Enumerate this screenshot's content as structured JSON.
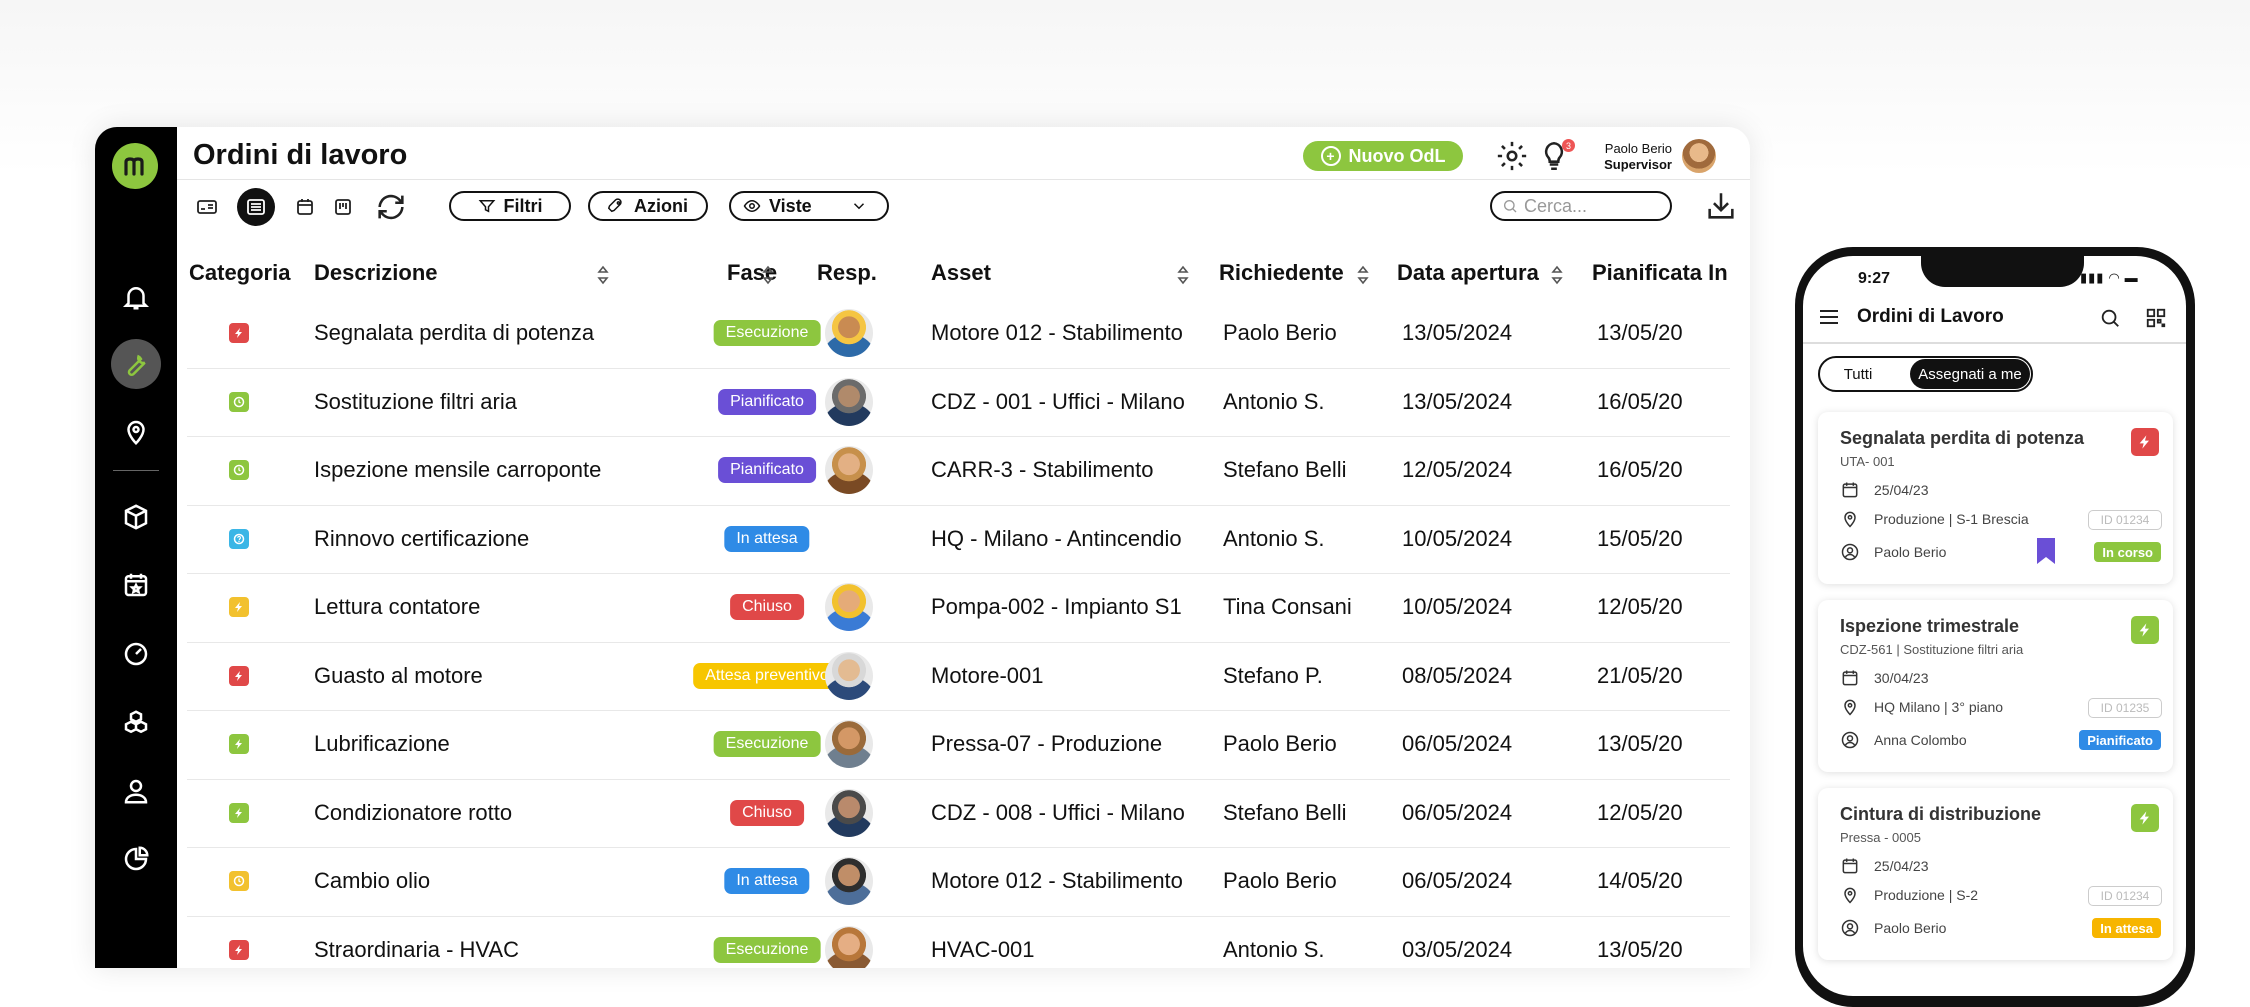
{
  "app": {
    "title": "Ordini di lavoro",
    "new_button": "Nuovo OdL",
    "notifications_count": "3",
    "user_name": "Paolo Berio",
    "user_role": "Supervisor",
    "filters_label": "Filtri",
    "actions_label": "Azioni",
    "views_label": "Viste",
    "search_placeholder": "Cerca...",
    "accent_color": "#8dc63f"
  },
  "table": {
    "headers": {
      "categoria": "Categoria",
      "descrizione": "Descrizione",
      "fase": "Fase",
      "resp": "Resp.",
      "asset": "Asset",
      "richiedente": "Richiedente",
      "data_apertura": "Data apertura",
      "pianificata": "Pianificata In"
    },
    "rows": [
      {
        "cat_color": "#e04848",
        "cat_icon": "bolt-icon",
        "descrizione": "Segnalata perdita di potenza",
        "fase": "Esecuzione",
        "fase_color": "#8dc63f",
        "asset": "Motore 012 - Stabilimento",
        "richiedente": "Paolo Berio",
        "data_apertura": "13/05/2024",
        "pianificata": "13/05/20",
        "resp_avatar": "person-avatar"
      },
      {
        "cat_color": "#8dc63f",
        "cat_icon": "clock-icon",
        "descrizione": "Sostituzione filtri aria",
        "fase": "Pianificato",
        "fase_color": "#6a4fd6",
        "asset": "CDZ - 001 - Uffici - Milano",
        "richiedente": "Antonio S.",
        "data_apertura": "13/05/2024",
        "pianificata": "16/05/20",
        "resp_avatar": "person-avatar"
      },
      {
        "cat_color": "#8dc63f",
        "cat_icon": "clock-icon",
        "descrizione": "Ispezione mensile carroponte",
        "fase": "Pianificato",
        "fase_color": "#6a4fd6",
        "asset": "CARR-3 - Stabilimento",
        "richiedente": "Stefano Belli",
        "data_apertura": "12/05/2024",
        "pianificata": "16/05/20",
        "resp_avatar": "person-avatar"
      },
      {
        "cat_color": "#3bb6e6",
        "cat_icon": "question-icon",
        "descrizione": "Rinnovo certificazione",
        "fase": "In attesa",
        "fase_color": "#2f8be6",
        "asset": "HQ - Milano - Antincendio",
        "richiedente": "Antonio S.",
        "data_apertura": "10/05/2024",
        "pianificata": "15/05/20",
        "resp_avatar": ""
      },
      {
        "cat_color": "#f2c12e",
        "cat_icon": "bolt-icon",
        "descrizione": "Lettura contatore",
        "fase": "Chiuso",
        "fase_color": "#e04848",
        "asset": "Pompa-002 - Impianto S1",
        "richiedente": "Tina Consani",
        "data_apertura": "10/05/2024",
        "pianificata": "12/05/20",
        "resp_avatar": "person-avatar"
      },
      {
        "cat_color": "#e04848",
        "cat_icon": "bolt-icon",
        "descrizione": "Guasto al motore",
        "fase": "Attesa preventivo",
        "fase_color": "#f7c600",
        "asset": "Motore-001",
        "richiedente": "Stefano P.",
        "data_apertura": "08/05/2024",
        "pianificata": "21/05/20",
        "resp_avatar": "person-avatar"
      },
      {
        "cat_color": "#8dc63f",
        "cat_icon": "bolt-icon",
        "descrizione": "Lubrificazione",
        "fase": "Esecuzione",
        "fase_color": "#8dc63f",
        "asset": "Pressa-07 - Produzione",
        "richiedente": "Paolo Berio",
        "data_apertura": "06/05/2024",
        "pianificata": "13/05/20",
        "resp_avatar": "person-avatar"
      },
      {
        "cat_color": "#8dc63f",
        "cat_icon": "bolt-icon",
        "descrizione": "Condizionatore rotto",
        "fase": "Chiuso",
        "fase_color": "#e04848",
        "asset": "CDZ - 008 - Uffici - Milano",
        "richiedente": "Stefano Belli",
        "data_apertura": "06/05/2024",
        "pianificata": "12/05/20",
        "resp_avatar": "person-avatar"
      },
      {
        "cat_color": "#f2c12e",
        "cat_icon": "clock-icon",
        "descrizione": "Cambio olio",
        "fase": "In attesa",
        "fase_color": "#2f8be6",
        "asset": "Motore 012 - Stabilimento",
        "richiedente": "Paolo Berio",
        "data_apertura": "06/05/2024",
        "pianificata": "14/05/20",
        "resp_avatar": "person-avatar"
      },
      {
        "cat_color": "#e04848",
        "cat_icon": "bolt-icon",
        "descrizione": "Straordinaria - HVAC",
        "fase": "Esecuzione",
        "fase_color": "#8dc63f",
        "asset": "HVAC-001",
        "richiedente": "Antonio S.",
        "data_apertura": "03/05/2024",
        "pianificata": "13/05/20",
        "resp_avatar": "person-avatar"
      }
    ]
  },
  "phone": {
    "time": "9:27",
    "title": "Ordini di Lavoro",
    "tab_all": "Tutti",
    "tab_mine": "Assegnati a me",
    "cards": [
      {
        "title": "Segnalata perdita di potenza",
        "subtitle": "UTA- 001",
        "date": "25/04/23",
        "location": "Produzione | S-1 Brescia",
        "id": "ID 01234",
        "person": "Paolo Berio",
        "status": "In corso",
        "status_color": "#8dc63f",
        "cat_color": "#e04848",
        "bookmark": true
      },
      {
        "title": "Ispezione trimestrale",
        "subtitle": "CDZ-561 | Sostituzione filtri aria",
        "date": "30/04/23",
        "location": "HQ Milano | 3° piano",
        "id": "ID 01235",
        "person": "Anna Colombo",
        "status": "Pianificato",
        "status_color": "#2f8be6",
        "cat_color": "#8dc63f",
        "bookmark": false
      },
      {
        "title": "Cintura di distribuzione",
        "subtitle": "Pressa - 0005",
        "date": "25/04/23",
        "location": "Produzione | S-2",
        "id": "ID 01234",
        "person": "Paolo Berio",
        "status": "In attesa",
        "status_color": "#f7b500",
        "cat_color": "#8dc63f",
        "bookmark": false
      }
    ]
  }
}
